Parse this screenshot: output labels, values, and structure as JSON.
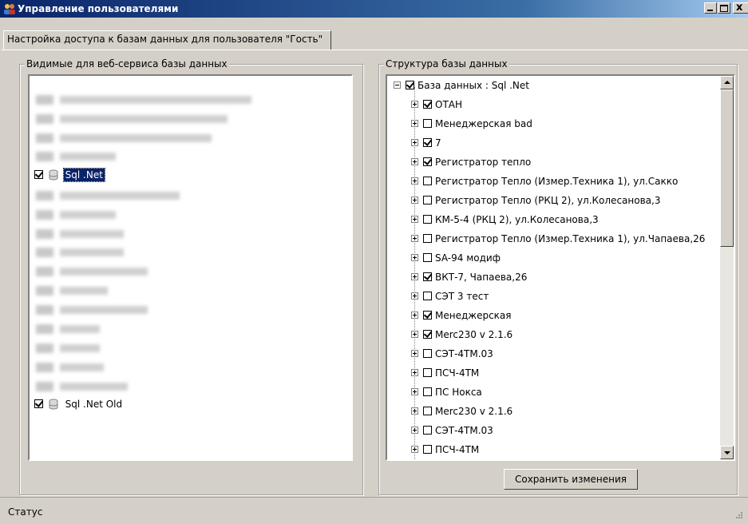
{
  "window": {
    "title": "Управление пользователями",
    "close_glyph": "x"
  },
  "tab": {
    "label": "Настройка доступа к базам данных для пользователя \"Гость\""
  },
  "left_panel": {
    "title": "Видимые для веб-сервиса базы данных",
    "items": [
      {
        "label": "Sql .Net",
        "checked": true,
        "selected": true
      },
      {
        "label": "Sql .Net Old",
        "checked": true,
        "selected": false
      }
    ]
  },
  "right_panel": {
    "title": "Структура базы данных",
    "root": {
      "label": "База данных : Sql .Net",
      "checked": true
    },
    "nodes": [
      {
        "label": "ОТАН",
        "checked": true
      },
      {
        "label": "Менеджерская bad",
        "checked": false
      },
      {
        "label": "7",
        "checked": true
      },
      {
        "label": "Регистратор тепло",
        "checked": true
      },
      {
        "label": "Регистратор Тепло (Измер.Техника 1), ул.Сакко",
        "checked": false
      },
      {
        "label": "Регистратор Тепло (РКЦ 2), ул.Колесанова,3",
        "checked": false
      },
      {
        "label": "КМ-5-4 (РКЦ 2), ул.Колесанова,3",
        "checked": false
      },
      {
        "label": "Регистратор Тепло (Измер.Техника 1), ул.Чапаева,26",
        "checked": false
      },
      {
        "label": "SA-94 модиф",
        "checked": false
      },
      {
        "label": "ВКТ-7, Чапаева,26",
        "checked": true
      },
      {
        "label": "СЭТ 3 тест",
        "checked": false
      },
      {
        "label": "Менеджерская",
        "checked": true
      },
      {
        "label": "Merc230 v 2.1.6",
        "checked": true
      },
      {
        "label": "СЭТ-4ТМ.03",
        "checked": false
      },
      {
        "label": "ПСЧ-4ТМ",
        "checked": false
      },
      {
        "label": "ПС Нокса",
        "checked": false
      },
      {
        "label": "Merc230 v 2.1.6",
        "checked": false
      },
      {
        "label": "СЭТ-4ТМ.03",
        "checked": false
      },
      {
        "label": "ПСЧ-4ТМ",
        "checked": false
      }
    ],
    "save_button": "Сохранить изменения"
  },
  "status": {
    "text": "Статус"
  }
}
